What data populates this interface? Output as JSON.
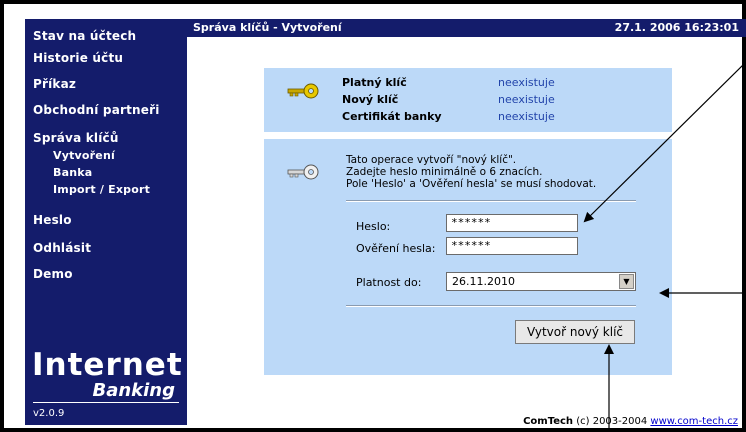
{
  "sidebar": {
    "items": [
      {
        "label": "Stav na účtech"
      },
      {
        "label": "Historie účtu"
      },
      {
        "label": "Příkaz"
      },
      {
        "label": "Obchodní partneři"
      },
      {
        "label": "Správa klíčů"
      },
      {
        "label": "Vytvoření"
      },
      {
        "label": "Banka"
      },
      {
        "label": "Import / Export"
      },
      {
        "label": "Heslo"
      },
      {
        "label": "Odhlásit"
      },
      {
        "label": "Demo"
      }
    ],
    "logo_line1": "Internet",
    "logo_line2": "Banking",
    "version": "v2.0.9"
  },
  "header": {
    "title": "Správa klíčů - Vytvoření",
    "datetime": "27.1. 2006  16:23:01"
  },
  "status_panel": {
    "rows": [
      {
        "label": "Platný klíč",
        "value": "neexistuje"
      },
      {
        "label": "Nový klíč",
        "value": "neexistuje"
      },
      {
        "label": "Certifikát banky",
        "value": "neexistuje"
      }
    ]
  },
  "create_panel": {
    "info_lines": [
      "Tato operace vytvoří \"nový klíč\".",
      "Zadejte heslo minimálně o 6 znacích.",
      "Pole 'Heslo' a 'Ověření hesla' se musí shodovat."
    ],
    "password_label": "Heslo:",
    "password_value": "******",
    "confirm_label": "Ověření hesla:",
    "confirm_value": "******",
    "validity_label": "Platnost do:",
    "validity_value": "26.11.2010",
    "create_button": "Vytvoř nový klíč"
  },
  "footer": {
    "brand": "ComTech",
    "copyright": " (c) 2003-2004 ",
    "link": "www.com-tech.cz"
  }
}
